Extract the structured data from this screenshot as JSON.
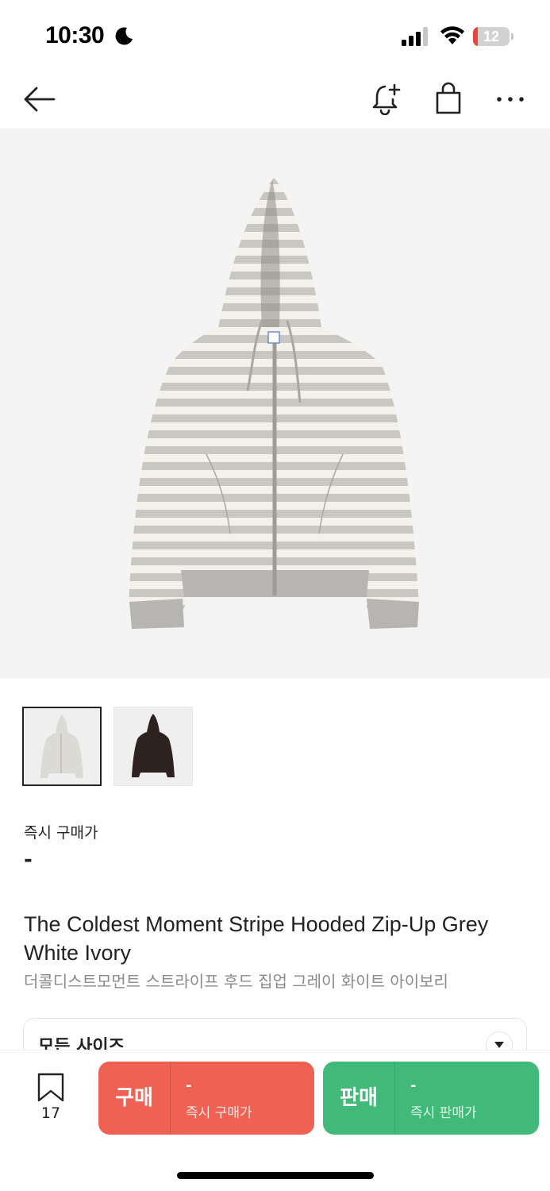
{
  "status_bar": {
    "time": "10:30",
    "battery_level": "12",
    "battery_fraction": 0.12
  },
  "nav": {
    "back_icon": "arrow-left-icon",
    "alert_icon": "bell-plus-icon",
    "bag_icon": "shopping-bag-icon",
    "more_icon": "more-horizontal-icon"
  },
  "thumbnails": [
    {
      "name": "grey-white-ivory",
      "selected": true
    },
    {
      "name": "black",
      "selected": false
    }
  ],
  "price": {
    "label": "즉시 구매가",
    "value": "-"
  },
  "product": {
    "title_en": "The Coldest Moment Stripe Hooded Zip-Up Grey White Ivory",
    "title_ko": "더콜디스트모먼트 스트라이프 후드 집업 그레이 화이트 아이보리"
  },
  "size_selector": {
    "label": "모든 사이즈"
  },
  "bottom_bar": {
    "wish_count": "17",
    "buy": {
      "label": "구매",
      "price": "-",
      "sub": "즉시 구매가"
    },
    "sell": {
      "label": "판매",
      "price": "-",
      "sub": "즉시 판매가"
    }
  },
  "colors": {
    "buy": "#ef6253",
    "sell": "#41b979",
    "stripe_grey": "#c9c7c1",
    "stripe_ivory": "#f3f1ea"
  }
}
